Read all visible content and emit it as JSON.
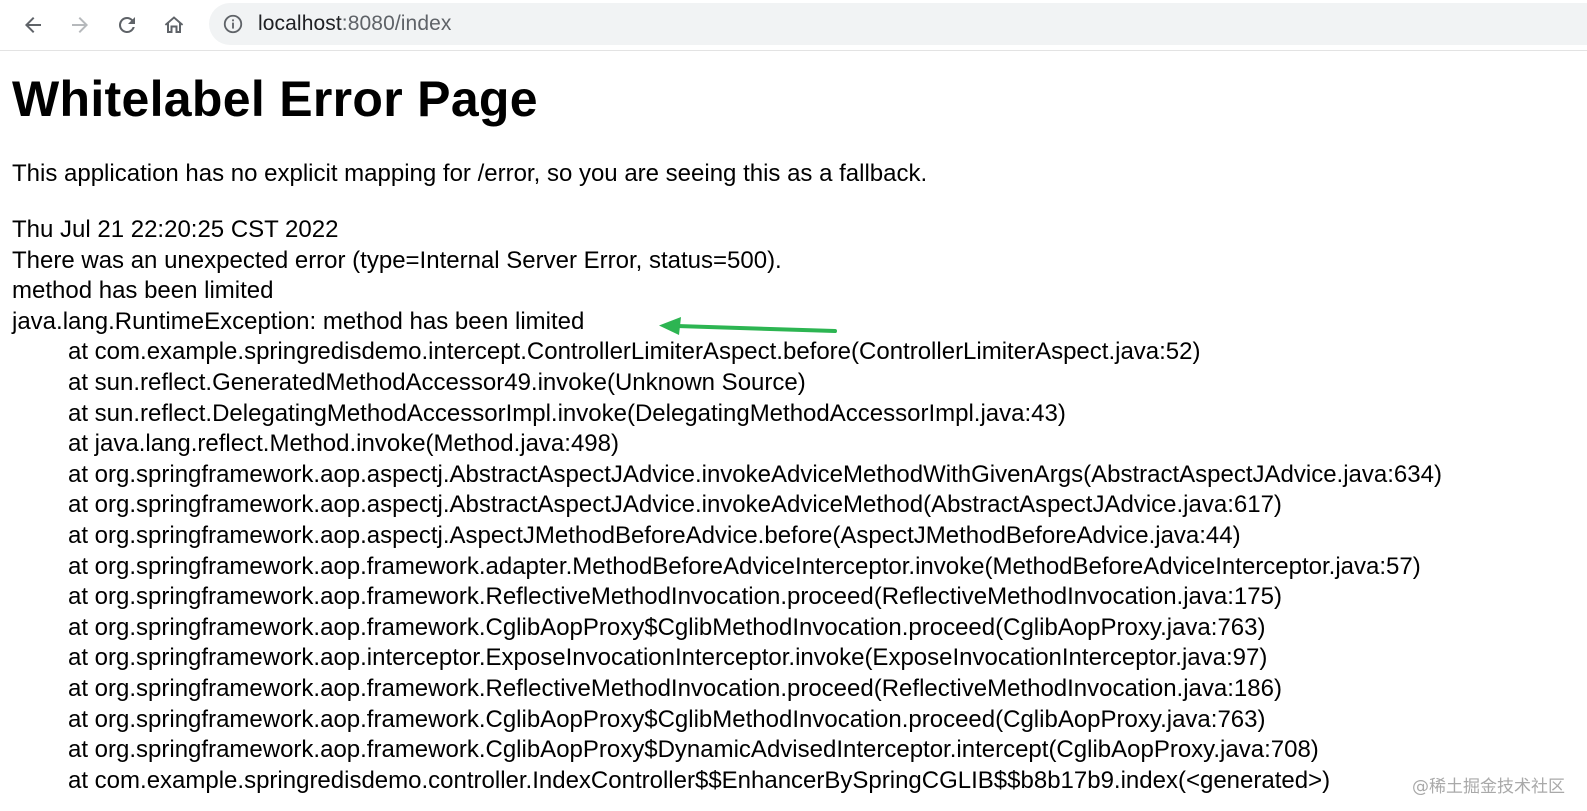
{
  "browser": {
    "url_host": "localhost",
    "url_rest": ":8080/index"
  },
  "page": {
    "title": "Whitelabel Error Page",
    "description": "This application has no explicit mapping for /error, so you are seeing this as a fallback.",
    "timestamp": "Thu Jul 21 22:20:25 CST 2022",
    "error_line": "There was an unexpected error (type=Internal Server Error, status=500).",
    "message": "method has been limited",
    "exception": "java.lang.RuntimeException: method has been limited",
    "stack": [
      "at com.example.springredisdemo.intercept.ControllerLimiterAspect.before(ControllerLimiterAspect.java:52)",
      "at sun.reflect.GeneratedMethodAccessor49.invoke(Unknown Source)",
      "at sun.reflect.DelegatingMethodAccessorImpl.invoke(DelegatingMethodAccessorImpl.java:43)",
      "at java.lang.reflect.Method.invoke(Method.java:498)",
      "at org.springframework.aop.aspectj.AbstractAspectJAdvice.invokeAdviceMethodWithGivenArgs(AbstractAspectJAdvice.java:634)",
      "at org.springframework.aop.aspectj.AbstractAspectJAdvice.invokeAdviceMethod(AbstractAspectJAdvice.java:617)",
      "at org.springframework.aop.aspectj.AspectJMethodBeforeAdvice.before(AspectJMethodBeforeAdvice.java:44)",
      "at org.springframework.aop.framework.adapter.MethodBeforeAdviceInterceptor.invoke(MethodBeforeAdviceInterceptor.java:57)",
      "at org.springframework.aop.framework.ReflectiveMethodInvocation.proceed(ReflectiveMethodInvocation.java:175)",
      "at org.springframework.aop.framework.CglibAopProxy$CglibMethodInvocation.proceed(CglibAopProxy.java:763)",
      "at org.springframework.aop.interceptor.ExposeInvocationInterceptor.invoke(ExposeInvocationInterceptor.java:97)",
      "at org.springframework.aop.framework.ReflectiveMethodInvocation.proceed(ReflectiveMethodInvocation.java:186)",
      "at org.springframework.aop.framework.CglibAopProxy$CglibMethodInvocation.proceed(CglibAopProxy.java:763)",
      "at org.springframework.aop.framework.CglibAopProxy$DynamicAdvisedInterceptor.intercept(CglibAopProxy.java:708)",
      "at com.example.springredisdemo.controller.IndexController$$EnhancerBySpringCGLIB$$b8b17b9.index(<generated>)"
    ]
  },
  "watermark": "@稀土掘金技术社区",
  "icons": {
    "back": "back-arrow-icon",
    "forward": "forward-arrow-icon",
    "reload": "reload-icon",
    "home": "home-icon",
    "info": "info-icon",
    "annotation": "annotation-arrow-icon"
  },
  "colors": {
    "annotation_arrow": "#2db552",
    "omnibox_bg": "#f1f3f4"
  }
}
